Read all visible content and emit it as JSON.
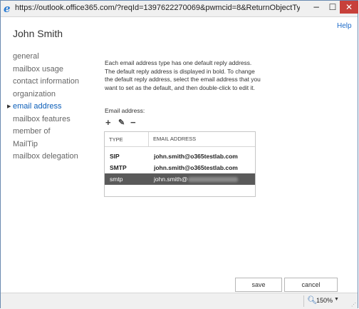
{
  "browser": {
    "url": "https://outlook.office365.com/?reqId=1397622270069&pwmcid=8&ReturnObjectTyp...",
    "minimize_glyph": "−",
    "maximize_glyph": "☐",
    "close_glyph": "✕"
  },
  "header": {
    "help_label": "Help",
    "user_name": "John Smith"
  },
  "nav": {
    "items": [
      {
        "label": "general"
      },
      {
        "label": "mailbox usage"
      },
      {
        "label": "contact information"
      },
      {
        "label": "organization"
      },
      {
        "label": "email address",
        "active": true
      },
      {
        "label": "mailbox features"
      },
      {
        "label": "member of"
      },
      {
        "label": "MailTip"
      },
      {
        "label": "mailbox delegation"
      }
    ],
    "active_marker": "▶"
  },
  "content": {
    "description": "Each email address type has one default reply address. The default reply address is displayed in bold. To change the default reply address, select the email address that you want to set as the default, and then double-click to edit it.",
    "email_label": "Email address:",
    "toolbar": {
      "add_glyph": "+",
      "edit_glyph": "✎",
      "remove_glyph": "−"
    },
    "table": {
      "headers": {
        "type": "TYPE",
        "email": "EMAIL ADDRESS"
      },
      "rows": [
        {
          "type": "SIP",
          "email": "john.smith@o365testlab.com",
          "bold": true,
          "selected": false
        },
        {
          "type": "SMTP",
          "email": "john.smith@o365testlab.com",
          "bold": true,
          "selected": false
        },
        {
          "type": "smtp",
          "email": "john.smith@",
          "bold": false,
          "selected": true,
          "redacted": true
        }
      ]
    }
  },
  "buttons": {
    "save": "save",
    "cancel": "cancel"
  },
  "statusbar": {
    "zoom": "150%",
    "zoom_icon": "zoom-icon",
    "zoom_arrow": "▼"
  },
  "colors": {
    "accent": "#0b5eb9",
    "selected_row": "#5a5a5a",
    "close_button": "#c7403a"
  }
}
